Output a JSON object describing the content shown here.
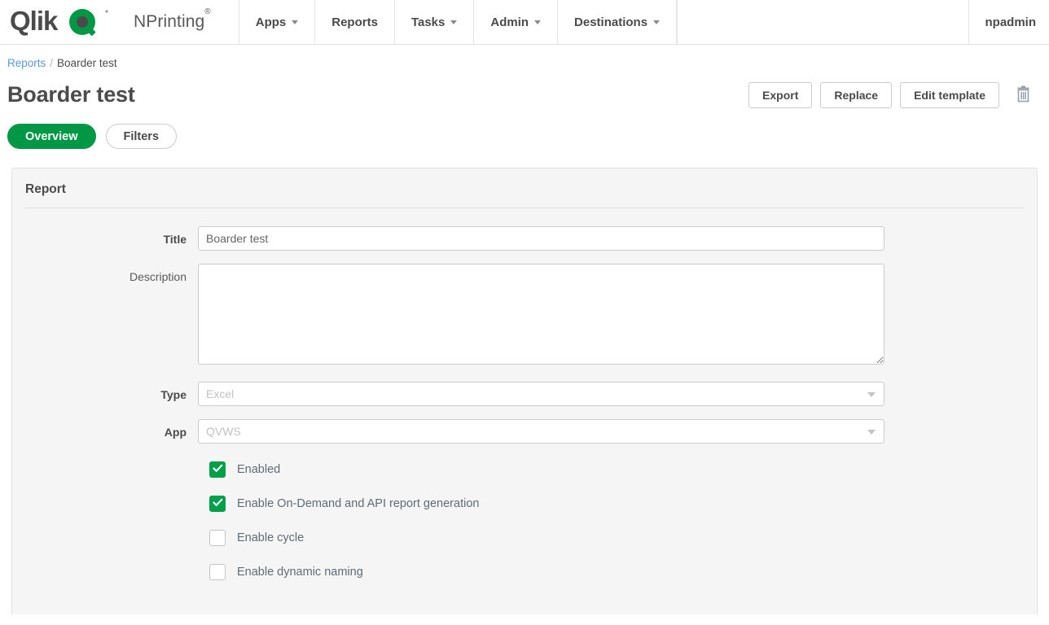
{
  "header": {
    "logo_alt": "Qlik",
    "logo_text": "Qlik",
    "product_name": "NPrinting",
    "product_sup": "®",
    "nav": [
      {
        "label": "Apps",
        "has_caret": true
      },
      {
        "label": "Reports",
        "has_caret": false
      },
      {
        "label": "Tasks",
        "has_caret": true
      },
      {
        "label": "Admin",
        "has_caret": true
      },
      {
        "label": "Destinations",
        "has_caret": true
      }
    ],
    "user": "npadmin"
  },
  "breadcrumb": {
    "parent": "Reports",
    "separator": "/",
    "current": "Boarder test"
  },
  "page": {
    "title": "Boarder test",
    "actions": {
      "export": "Export",
      "replace": "Replace",
      "edit_template": "Edit template",
      "delete_icon": "trash-icon"
    }
  },
  "tabs": [
    {
      "label": "Overview",
      "active": true
    },
    {
      "label": "Filters",
      "active": false
    }
  ],
  "panel": {
    "title": "Report",
    "fields": {
      "title": {
        "label": "Title",
        "value": "Boarder test",
        "placeholder": ""
      },
      "description": {
        "label": "Description",
        "value": "",
        "placeholder": ""
      },
      "type": {
        "label": "Type",
        "value": "Excel"
      },
      "app": {
        "label": "App",
        "value": "QVWS"
      }
    },
    "checkboxes": [
      {
        "label": "Enabled",
        "checked": true
      },
      {
        "label": "Enable On-Demand and API report generation",
        "checked": true
      },
      {
        "label": "Enable cycle",
        "checked": false
      },
      {
        "label": "Enable dynamic naming",
        "checked": false
      }
    ]
  },
  "colors": {
    "brand_green": "#009845",
    "checkbox_green": "#00A04A",
    "link_blue": "#5a9bd5",
    "text_dark": "#4b4b4b",
    "panel_bg": "#f5f5f5"
  }
}
